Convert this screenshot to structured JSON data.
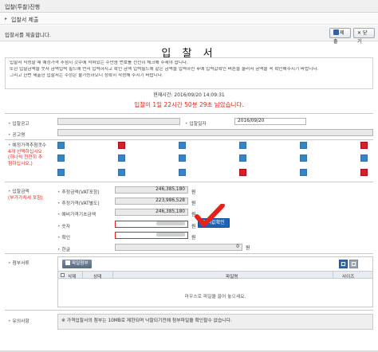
{
  "window": {
    "title": "입찰(투찰)진행"
  },
  "breadcrumb": {
    "label": "입찰서 제출"
  },
  "header": {
    "instruction": "입찰서를 제출합니다.",
    "submit_label": "제출",
    "close_label": "닫기"
  },
  "document": {
    "title": "입 찰 서",
    "notice_lines": [
      "입찰서 작성할 때 예정가격 추첨시 갓수에 적혀있는 수만큼 번호를 전천히 체크해 주세야 합니다.",
      "또한 입찰금액을 숫자 금액입력 필드에 먼저 입력하시고 확인 금액 입력필드에 같은 금액을 입력하신 후에 입력값확인 버튼을 눌러서 금액을 꼭 확인해주시기 바랍니다.",
      "그리고 한번 제출한 입찰서는 수정은 불가능하오니 정확히 작성해 주시기 바랍니다."
    ],
    "current_time": "현재시간: 2016/09/20 14:09:31",
    "deadline": "입찰이 1일 22시간 50분 29초 남았습니다."
  },
  "form": {
    "bid_notice_label": "입찰공고",
    "bid_date_label": "입찰일자",
    "bid_date_value": "2016/09/20",
    "bid_name_label": "공고명",
    "lottery_label_line1": "예정가격추첨갯수",
    "lottery_label_line2": "4개 선택하십시오",
    "lottery_label_line3": "(하나씩 천천히 추",
    "lottery_label_line4": "첨하십시오.)",
    "lottery_grid": [
      [
        "blue",
        "red",
        "blue",
        "blue",
        "blue",
        "red"
      ],
      [
        "blue",
        "blue",
        "blue",
        "blue",
        "blue",
        "blue"
      ],
      [
        "blue",
        "blue",
        "blue",
        "red",
        "blue",
        "red"
      ]
    ],
    "bid_amount_label": "입찰금액",
    "bid_amount_sub": "(부가가치세 포함)",
    "amounts": [
      {
        "label": "추정금액(VAT포함)",
        "value": "246,385,180",
        "unit": "원"
      },
      {
        "label": "추정가격(VAT별도)",
        "value": "223,986,528",
        "unit": "원"
      },
      {
        "label": "예비가격기초금액",
        "value": "246,385,180",
        "unit": "원"
      }
    ],
    "number_label": "숫자",
    "confirm_label": "확인",
    "hangul_label": "한글",
    "won": "원",
    "hangul_value": "0",
    "hangul_unit": "원",
    "check_button_label": "입력값확인",
    "attachments_label": "첨부서류",
    "attach_button_label": "파일첨부",
    "file_columns": {
      "delete": "삭제",
      "status": "상태",
      "filename": "파일명",
      "size": "사이즈"
    },
    "file_empty_text": "마우스로 파일을 끌어 놓으세요.",
    "notes_label": "유의사항",
    "notes_text": "※ 가격입찰서의 첨부는 10MB로 제한되며 낙찰되기전에 첨부파일을 확인할수 없습니다."
  },
  "colors": {
    "accent_red": "#e0251b",
    "blue_square": "#2f86c9",
    "red_square": "#d81f26",
    "button_blue": "#1a63b8"
  }
}
